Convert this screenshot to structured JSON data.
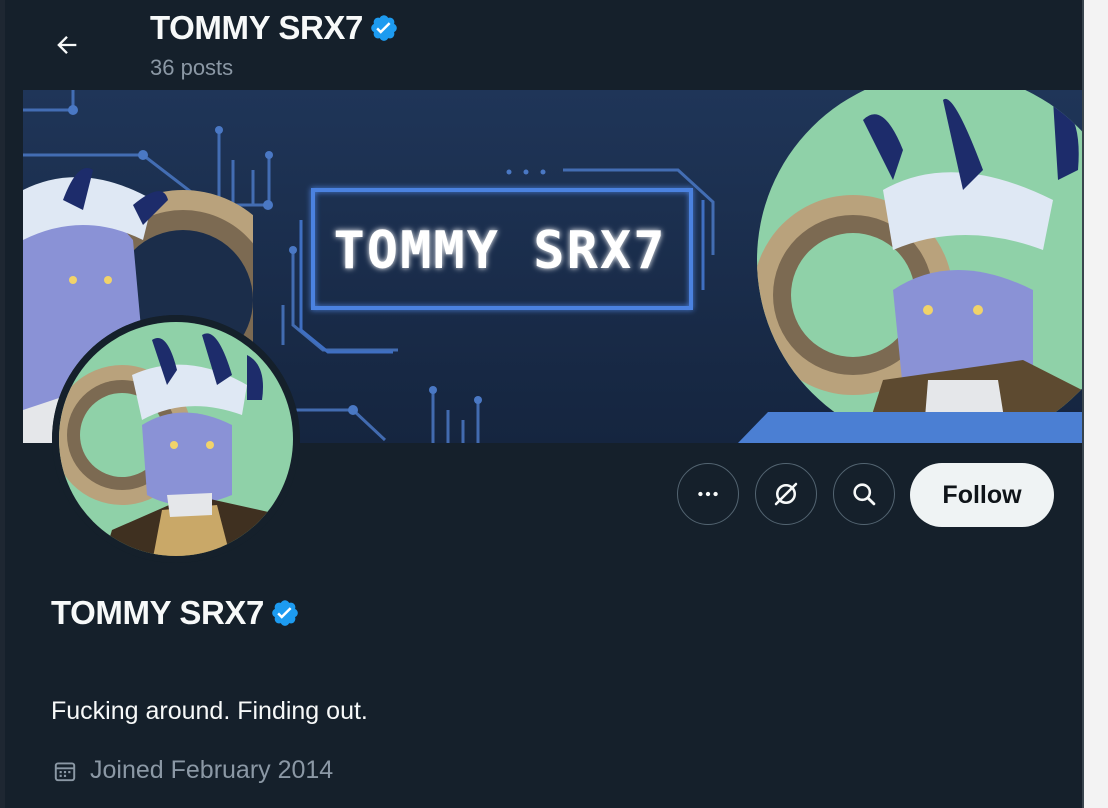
{
  "header": {
    "title": "TOMMY SRX7",
    "posts_count": "36 posts"
  },
  "banner": {
    "text": "TOMMY SRX7"
  },
  "profile": {
    "display_name": "TOMMY SRX7",
    "bio": "Fucking around. Finding out.",
    "joined": "Joined February 2014",
    "verified": true
  },
  "actions": {
    "more_icon": "more-icon",
    "grok_icon": "grok-icon",
    "search_icon": "search-icon",
    "follow_label": "Follow"
  },
  "colors": {
    "background": "#15202b",
    "verified_blue": "#1d9bf0",
    "muted_text": "#8b98a5",
    "follow_bg": "#eff3f4",
    "banner_bg": "#1b2d4a",
    "banner_accent": "#4b7fd3",
    "portrait_green": "#8fd1a8"
  }
}
